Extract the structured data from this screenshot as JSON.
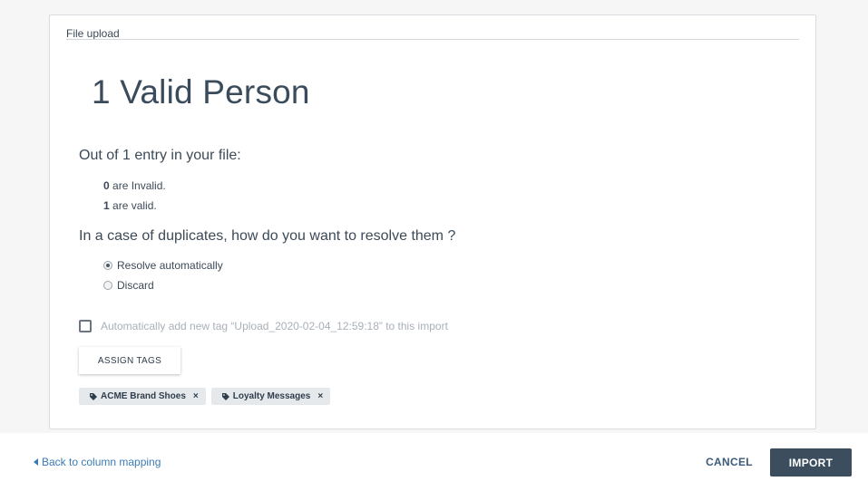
{
  "upload": {
    "section_title": "File upload",
    "headline": "1 Valid Person",
    "summary": "Out of 1 entry in your file:",
    "invalid_count": "0",
    "invalid_text": " are Invalid.",
    "valid_count": "1",
    "valid_text": " are valid.",
    "duplicates_question": "In a case of duplicates, how do you want to resolve them ?",
    "options": [
      {
        "label": "Resolve automatically",
        "selected": true
      },
      {
        "label": "Discard",
        "selected": false
      }
    ],
    "auto_tag_label": "Automatically add new tag “Upload_2020-02-04_12:59:18” to this import",
    "auto_tag_checked": false,
    "assign_tags_label": "ASSIGN TAGS",
    "tags": [
      {
        "label": "ACME Brand Shoes",
        "icon": "tag-icon",
        "remove": "×"
      },
      {
        "label": "Loyalty Messages",
        "icon": "tag-icon",
        "remove": "×"
      }
    ]
  },
  "footer": {
    "back_label": "Back to column mapping",
    "cancel_label": "CANCEL",
    "import_label": "IMPORT"
  },
  "colors": {
    "link": "#3c7bb5",
    "primary_button": "#3c4d5e",
    "tag_background": "#e6e9ec"
  }
}
